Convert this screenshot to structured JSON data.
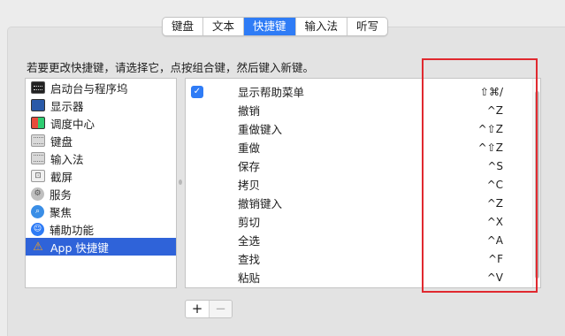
{
  "tabs": [
    "键盘",
    "文本",
    "快捷键",
    "输入法",
    "听写"
  ],
  "active_tab": "快捷键",
  "instruction": "若要更改快捷键，请选择它，点按组合键，然后键入新键。",
  "categories": [
    {
      "label": "启动台与程序坞",
      "icon": "launchpad-icon"
    },
    {
      "label": "显示器",
      "icon": "display-icon"
    },
    {
      "label": "调度中心",
      "icon": "mission-control-icon"
    },
    {
      "label": "键盘",
      "icon": "keyboard-icon"
    },
    {
      "label": "输入法",
      "icon": "input-source-icon"
    },
    {
      "label": "截屏",
      "icon": "screenshot-icon"
    },
    {
      "label": "服务",
      "icon": "services-gear-icon"
    },
    {
      "label": "聚焦",
      "icon": "spotlight-icon"
    },
    {
      "label": "辅助功能",
      "icon": "accessibility-icon"
    },
    {
      "label": "App 快捷键",
      "icon": "app-shortcuts-icon"
    }
  ],
  "selected_category": "App 快捷键",
  "shortcuts": [
    {
      "action": "显示帮助菜单",
      "keys": "⇧⌘/",
      "checked": true
    },
    {
      "action": "撤销",
      "keys": "^Z"
    },
    {
      "action": "重做键入",
      "keys": "^⇧Z"
    },
    {
      "action": "重做",
      "keys": "^⇧Z"
    },
    {
      "action": "保存",
      "keys": "^S"
    },
    {
      "action": "拷贝",
      "keys": "^C"
    },
    {
      "action": "撤销键入",
      "keys": "^Z"
    },
    {
      "action": "剪切",
      "keys": "^X"
    },
    {
      "action": "全选",
      "keys": "^A"
    },
    {
      "action": "查找",
      "keys": "^F"
    },
    {
      "action": "粘贴",
      "keys": "^V"
    }
  ],
  "buttons": {
    "add": "+",
    "remove": "−"
  },
  "colors": {
    "accent": "#2f7cf6",
    "selection": "#2f63d9",
    "annotation_box": "#e0292f"
  }
}
